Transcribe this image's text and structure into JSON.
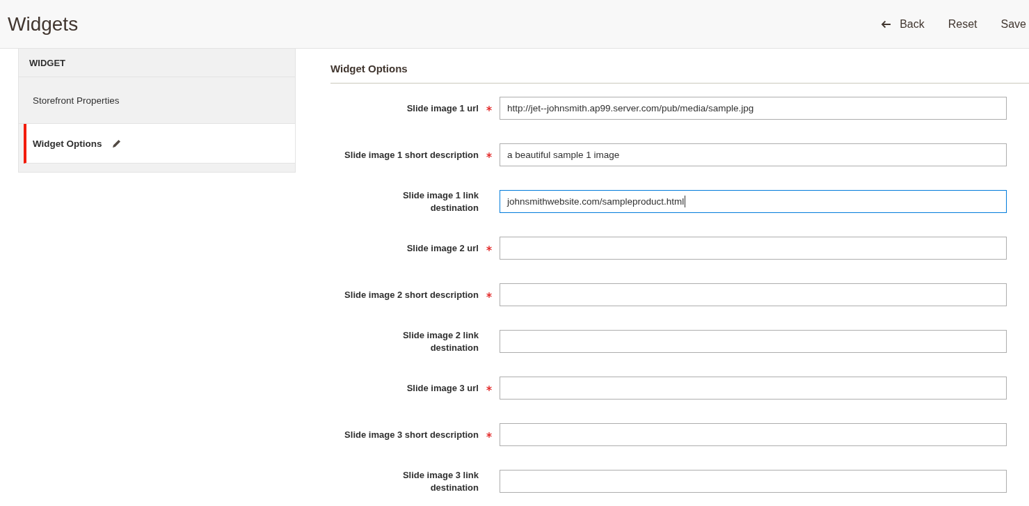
{
  "header": {
    "title": "Widgets",
    "actions": [
      {
        "label": "Back",
        "kind": "back"
      },
      {
        "label": "Reset",
        "kind": "plain"
      },
      {
        "label": "Save",
        "kind": "plain"
      }
    ]
  },
  "sidebar": {
    "section_title": "WIDGET",
    "items": [
      {
        "label": "Storefront Properties",
        "selected": false,
        "changed": false
      },
      {
        "label": "Widget Options",
        "selected": true,
        "changed": true
      }
    ]
  },
  "form": {
    "title": "Widget Options",
    "fields": [
      {
        "label": "Slide image 1 url",
        "required": true,
        "value": "http://jet--johnsmith.ap99.server.com/pub/media/sample.jpg",
        "focused": false
      },
      {
        "label": "Slide image 1 short description",
        "required": true,
        "value": "a beautiful sample 1 image",
        "focused": false
      },
      {
        "label": "Slide image 1 link\ndestination",
        "required": false,
        "value": "johnsmithwebsite.com/sampleproduct.html",
        "focused": true
      },
      {
        "label": "Slide image 2 url",
        "required": true,
        "focused": false
      },
      {
        "label": "Slide image 2 short description",
        "required": true,
        "focused": false
      },
      {
        "label": "Slide image 2 link\ndestination",
        "required": false,
        "focused": false
      },
      {
        "label": "Slide image 3 url",
        "required": true,
        "focused": false
      },
      {
        "label": "Slide image 3 short description",
        "required": true,
        "focused": false
      },
      {
        "label": "Slide image 3 link\ndestination",
        "required": false,
        "focused": false
      }
    ]
  }
}
